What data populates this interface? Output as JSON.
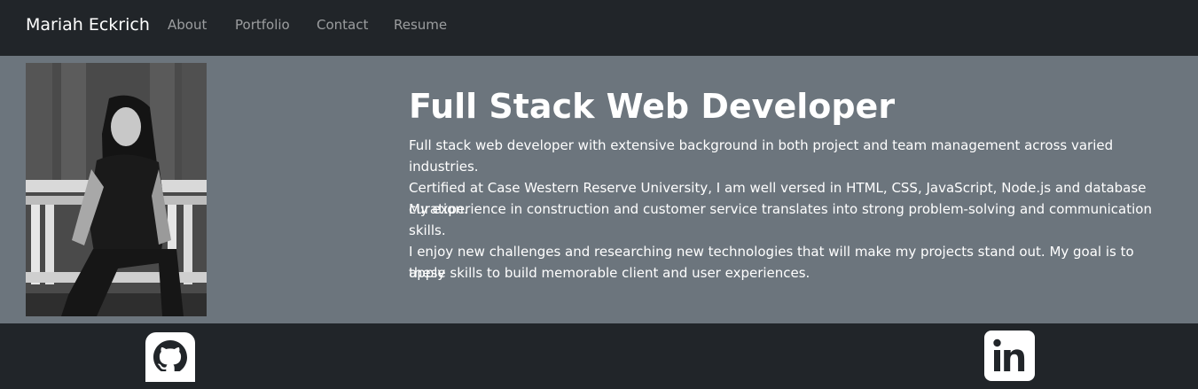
{
  "navbar": {
    "brand": "Mariah Eckrich",
    "links": [
      "About",
      "Portfolio",
      "Contact",
      "Resume"
    ]
  },
  "hero": {
    "title": "Full Stack Web Developer",
    "paragraphs": [
      "Full stack web developer with extensive background in both project and team management across varied industries.",
      "Certified at Case Western Reserve University, I am well versed in HTML, CSS, JavaScript, Node.js and database curation.",
      "My experience in construction and customer service translates into strong problem-solving and communication skills.",
      "I enjoy new challenges and researching new technologies that will make my projects stand out. My goal is to apply",
      "these skills to build memorable client and user experiences."
    ]
  },
  "footer": {
    "icons": [
      "github-icon",
      "linkedin-icon"
    ]
  },
  "colors": {
    "navbar_bg": "#212529",
    "hero_bg": "#6c757d",
    "text": "#ffffff",
    "nav_link": "rgba(255,255,255,0.55)"
  }
}
